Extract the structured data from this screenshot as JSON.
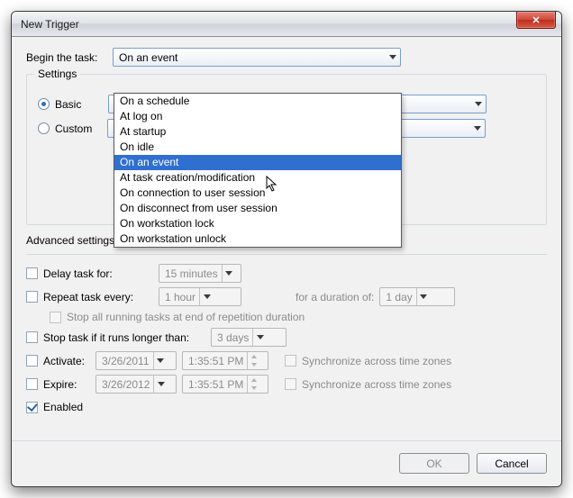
{
  "window": {
    "title": "New Trigger",
    "close_glyph": "✕"
  },
  "begin": {
    "label": "Begin the task:",
    "selected": "On an event",
    "options": [
      "On a schedule",
      "At log on",
      "At startup",
      "On idle",
      "On an event",
      "At task creation/modification",
      "On connection to user session",
      "On disconnect from user session",
      "On workstation lock",
      "On workstation unlock"
    ],
    "highlight_index": 4
  },
  "settings": {
    "legend": "Settings",
    "basic_label": "Basic",
    "custom_label": "Custom"
  },
  "advanced": {
    "legend": "Advanced settings",
    "delay_label": "Delay task for:",
    "delay_value": "15 minutes",
    "repeat_label": "Repeat task every:",
    "repeat_value": "1 hour",
    "duration_label": "for a duration of:",
    "duration_value": "1 day",
    "stop_end_label": "Stop all running tasks at end of repetition duration",
    "stop_longer_label": "Stop task if it runs longer than:",
    "stop_longer_value": "3 days",
    "activate_label": "Activate:",
    "activate_date": "3/26/2011",
    "activate_time": "1:35:51 PM",
    "expire_label": "Expire:",
    "expire_date": "3/26/2012",
    "expire_time": "1:35:51 PM",
    "sync_label": "Synchronize across time zones",
    "enabled_label": "Enabled"
  },
  "buttons": {
    "ok": "OK",
    "cancel": "Cancel"
  }
}
